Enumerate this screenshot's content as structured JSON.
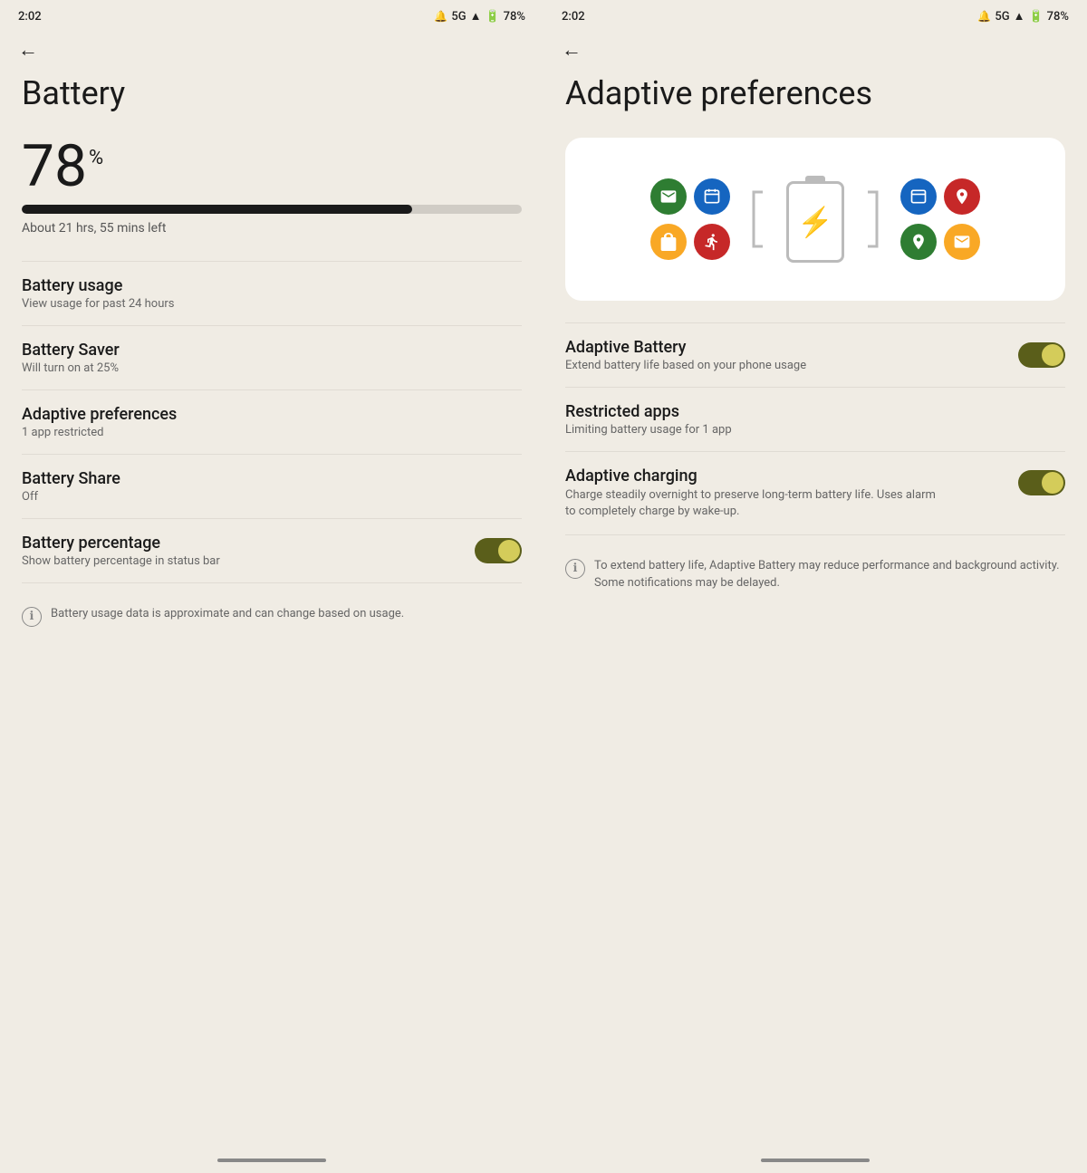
{
  "left_screen": {
    "status_bar": {
      "time": "2:02",
      "network": "5G",
      "battery_percent": "78%"
    },
    "back_label": "←",
    "title": "Battery",
    "battery": {
      "percent_number": "78",
      "percent_symbol": "%",
      "progress": 78,
      "time_left": "About 21 hrs, 55 mins left"
    },
    "menu_items": [
      {
        "title": "Battery usage",
        "subtitle": "View usage for past 24 hours"
      },
      {
        "title": "Battery Saver",
        "subtitle": "Will turn on at 25%"
      },
      {
        "title": "Adaptive preferences",
        "subtitle": "1 app restricted"
      },
      {
        "title": "Battery Share",
        "subtitle": "Off"
      }
    ],
    "battery_percentage_toggle": {
      "title": "Battery percentage",
      "subtitle": "Show battery percentage in status bar",
      "enabled": true
    },
    "info_text": "Battery usage data is approximate and can change based on usage."
  },
  "right_screen": {
    "status_bar": {
      "time": "2:02",
      "network": "5G",
      "battery_percent": "78%"
    },
    "back_label": "←",
    "title": "Adaptive preferences",
    "adaptive_battery": {
      "title": "Adaptive Battery",
      "subtitle": "Extend battery life based on your phone usage",
      "enabled": true
    },
    "restricted_apps": {
      "title": "Restricted apps",
      "subtitle": "Limiting battery usage for 1 app"
    },
    "adaptive_charging": {
      "title": "Adaptive charging",
      "subtitle": "Charge steadily overnight to preserve long-term battery life. Uses alarm to completely charge by wake-up.",
      "enabled": true
    },
    "info_text": "To extend battery life, Adaptive Battery may reduce performance and background activity. Some notifications may be delayed."
  },
  "icons": {
    "info": "ℹ",
    "bolt": "⚡"
  }
}
